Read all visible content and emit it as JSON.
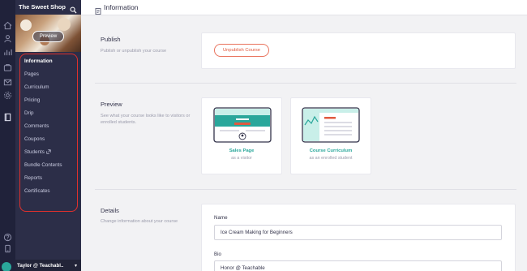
{
  "school_name": "The Sweet Shop",
  "preview_button": "Preview",
  "nav_items": [
    {
      "label": "Information",
      "active": true
    },
    {
      "label": "Pages"
    },
    {
      "label": "Curriculum"
    },
    {
      "label": "Pricing"
    },
    {
      "label": "Drip"
    },
    {
      "label": "Comments"
    },
    {
      "label": "Coupons"
    },
    {
      "label": "Students",
      "external": true
    },
    {
      "label": "Bundle Contents"
    },
    {
      "label": "Reports"
    },
    {
      "label": "Certificates"
    }
  ],
  "user_name": "Taylor @ Teachabl..",
  "header_title": "Information",
  "publish": {
    "title": "Publish",
    "description": "Publish or unpublish your course",
    "button": "Unpublish Course"
  },
  "preview": {
    "title": "Preview",
    "description": "See what your course looks like to visitors or enrolled students.",
    "sales_page": {
      "label": "Sales Page",
      "sub": "as a visitor"
    },
    "course_curriculum": {
      "label": "Course Curriculum",
      "sub": "as an enrolled student"
    }
  },
  "details": {
    "title": "Details",
    "description": "Change information about your course",
    "name_label": "Name",
    "name_value": "Ice Cream Making for Beginners",
    "bio_label": "Bio",
    "bio_value": "Honor @ Teachable"
  },
  "colors": {
    "accent_teal": "#2aa79b",
    "unpublish_orange": "#e05a3f",
    "highlight_red": "#e0302c",
    "sidebar": "#2c2e48"
  }
}
